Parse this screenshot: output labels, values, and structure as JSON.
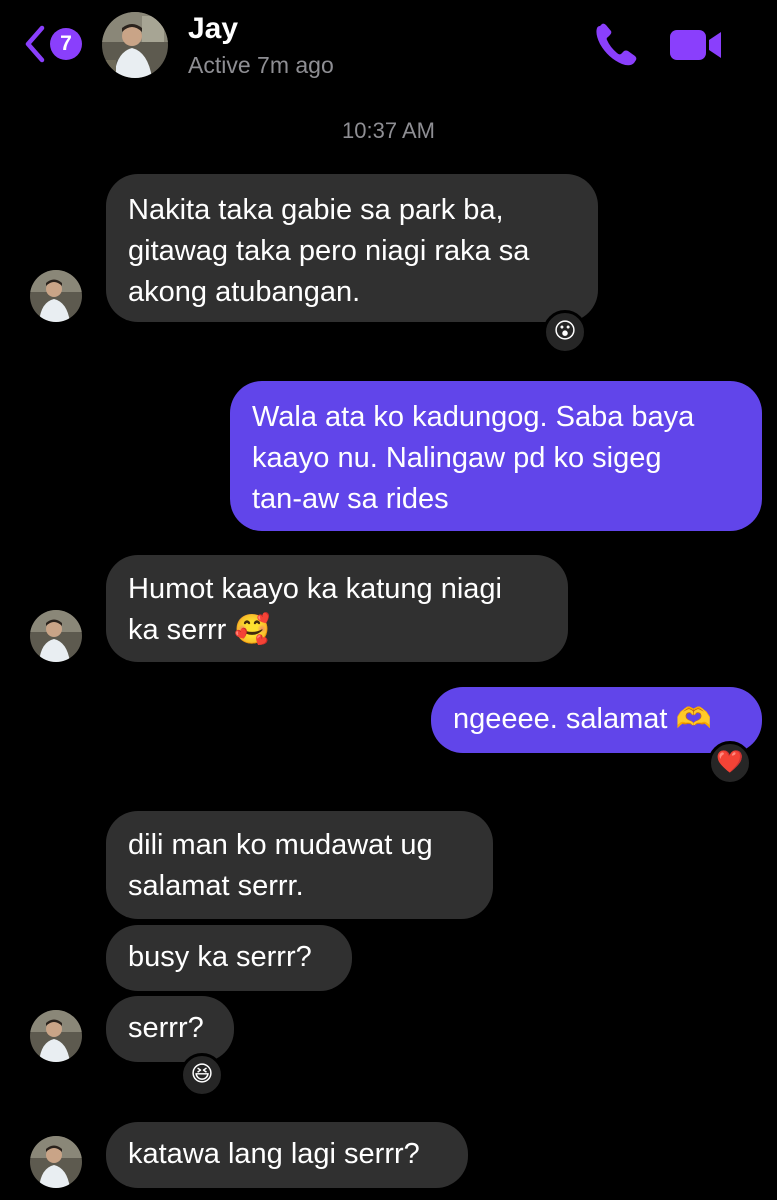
{
  "header": {
    "back_count": "7",
    "contact_name": "Jay",
    "status": "Active 7m ago",
    "accent_color": "#8a3ffc"
  },
  "timestamp": "10:37 AM",
  "messages": [
    {
      "side": "received",
      "text": "Nakita taka gabie sa park ba,\ngitawag taka pero niagi raka sa\nakong atubangan.",
      "reaction": "😮"
    },
    {
      "side": "sent",
      "text": "Wala ata ko kadungog. Saba baya\nkaayo nu. Nalingaw pd ko sigeg\ntan-aw sa rides"
    },
    {
      "side": "received",
      "text": "Humot kaayo ka katung niagi\nka serrr 🥰"
    },
    {
      "side": "sent",
      "text": "ngeeee. salamat 🫶",
      "reaction": "❤️"
    },
    {
      "side": "received",
      "text": "dili man ko mudawat ug\nsalamat serrr."
    },
    {
      "side": "received",
      "text": "busy ka serrr?"
    },
    {
      "side": "received",
      "text": "serrr?",
      "reaction": "😆"
    },
    {
      "side": "received",
      "text": "katawa lang lagi serrr?"
    }
  ],
  "icons": {
    "back": "chevron-left-icon",
    "call": "phone-icon",
    "video": "video-camera-icon"
  },
  "colors": {
    "sent_bubble": "#6145ea",
    "received_bubble": "#303030",
    "background": "#000000"
  }
}
